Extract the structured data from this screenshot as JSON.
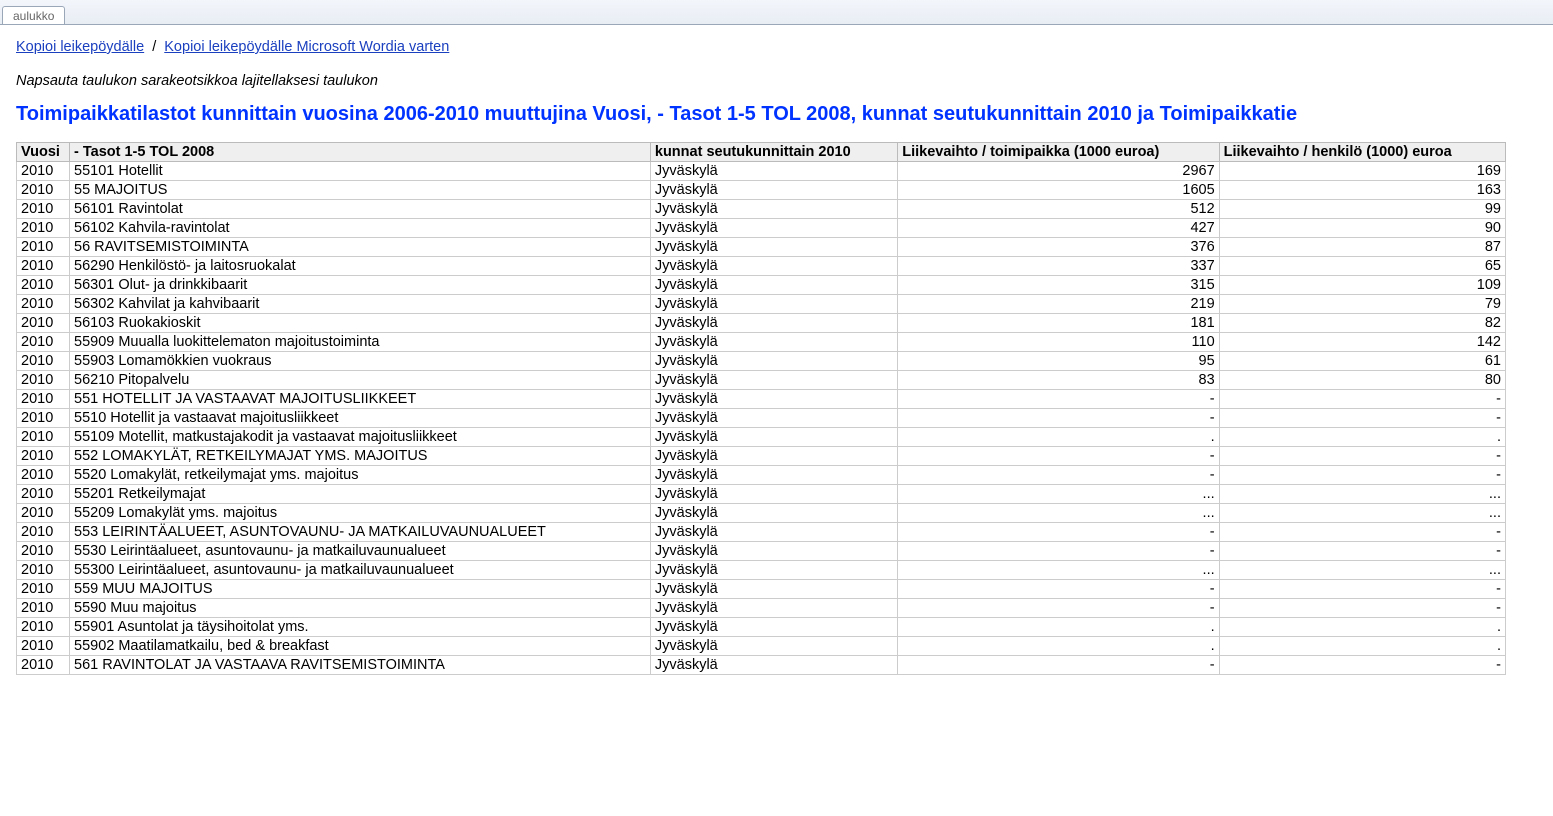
{
  "tab_label": "aulukko",
  "links": {
    "copy_clipboard": "Kopioi leikepöydälle",
    "copy_word": "Kopioi leikepöydälle Microsoft Wordia varten",
    "separator": "/"
  },
  "hint": "Napsauta taulukon sarakeotsikkoa lajitellaksesi taulukon",
  "title": "Toimipaikkatilastot kunnittain vuosina 2006-2010 muuttujina Vuosi, - Tasot 1-5 TOL 2008, kunnat seutukunnittain 2010 ja Toimipaikkatie",
  "columns": [
    "Vuosi",
    "- Tasot 1-5 TOL 2008",
    "kunnat seutukunnittain 2010",
    "Liikevaihto / toimipaikka (1000 euroa)",
    "Liikevaihto / henkilö (1000) euroa"
  ],
  "rows": [
    {
      "y": "2010",
      "t": "55101 Hotellit",
      "k": "Jyväskylä",
      "a": "2967",
      "b": "169"
    },
    {
      "y": "2010",
      "t": "55 MAJOITUS",
      "k": "Jyväskylä",
      "a": "1605",
      "b": "163"
    },
    {
      "y": "2010",
      "t": "56101 Ravintolat",
      "k": "Jyväskylä",
      "a": "512",
      "b": "99"
    },
    {
      "y": "2010",
      "t": "56102 Kahvila-ravintolat",
      "k": "Jyväskylä",
      "a": "427",
      "b": "90"
    },
    {
      "y": "2010",
      "t": "56 RAVITSEMISTOIMINTA",
      "k": "Jyväskylä",
      "a": "376",
      "b": "87"
    },
    {
      "y": "2010",
      "t": "56290 Henkilöstö- ja laitosruokalat",
      "k": "Jyväskylä",
      "a": "337",
      "b": "65"
    },
    {
      "y": "2010",
      "t": "56301 Olut- ja drinkkibaarit",
      "k": "Jyväskylä",
      "a": "315",
      "b": "109"
    },
    {
      "y": "2010",
      "t": "56302 Kahvilat ja kahvibaarit",
      "k": "Jyväskylä",
      "a": "219",
      "b": "79"
    },
    {
      "y": "2010",
      "t": "56103 Ruokakioskit",
      "k": "Jyväskylä",
      "a": "181",
      "b": "82"
    },
    {
      "y": "2010",
      "t": "55909 Muualla luokittelematon majoitustoiminta",
      "k": "Jyväskylä",
      "a": "110",
      "b": "142"
    },
    {
      "y": "2010",
      "t": "55903 Lomamökkien vuokraus",
      "k": "Jyväskylä",
      "a": "95",
      "b": "61"
    },
    {
      "y": "2010",
      "t": "56210 Pitopalvelu",
      "k": "Jyväskylä",
      "a": "83",
      "b": "80"
    },
    {
      "y": "2010",
      "t": "551 HOTELLIT JA VASTAAVAT MAJOITUSLIIKKEET",
      "k": "Jyväskylä",
      "a": "-",
      "b": "-"
    },
    {
      "y": "2010",
      "t": "5510 Hotellit ja vastaavat majoitusliikkeet",
      "k": "Jyväskylä",
      "a": "-",
      "b": "-"
    },
    {
      "y": "2010",
      "t": "55109 Motellit, matkustajakodit ja vastaavat majoitusliikkeet",
      "k": "Jyväskylä",
      "a": ".",
      "b": "."
    },
    {
      "y": "2010",
      "t": "552 LOMAKYLÄT, RETKEILYMAJAT YMS. MAJOITUS",
      "k": "Jyväskylä",
      "a": "-",
      "b": "-"
    },
    {
      "y": "2010",
      "t": "5520 Lomakylät, retkeilymajat yms. majoitus",
      "k": "Jyväskylä",
      "a": "-",
      "b": "-"
    },
    {
      "y": "2010",
      "t": "55201 Retkeilymajat",
      "k": "Jyväskylä",
      "a": "...",
      "b": "..."
    },
    {
      "y": "2010",
      "t": "55209 Lomakylät yms. majoitus",
      "k": "Jyväskylä",
      "a": "...",
      "b": "..."
    },
    {
      "y": "2010",
      "t": "553 LEIRINTÄALUEET, ASUNTOVAUNU- JA MATKAILUVAUNUALUEET",
      "k": "Jyväskylä",
      "a": "-",
      "b": "-"
    },
    {
      "y": "2010",
      "t": "5530 Leirintäalueet, asuntovaunu- ja matkailuvaunualueet",
      "k": "Jyväskylä",
      "a": "-",
      "b": "-"
    },
    {
      "y": "2010",
      "t": "55300 Leirintäalueet, asuntovaunu- ja matkailuvaunualueet",
      "k": "Jyväskylä",
      "a": "...",
      "b": "..."
    },
    {
      "y": "2010",
      "t": "559 MUU MAJOITUS",
      "k": "Jyväskylä",
      "a": "-",
      "b": "-"
    },
    {
      "y": "2010",
      "t": "5590 Muu majoitus",
      "k": "Jyväskylä",
      "a": "-",
      "b": "-"
    },
    {
      "y": "2010",
      "t": "55901 Asuntolat ja täysihoitolat yms.",
      "k": "Jyväskylä",
      "a": ".",
      "b": "."
    },
    {
      "y": "2010",
      "t": "55902 Maatilamatkailu, bed & breakfast",
      "k": "Jyväskylä",
      "a": ".",
      "b": "."
    },
    {
      "y": "2010",
      "t": "561 RAVINTOLAT JA VASTAAVA RAVITSEMISTOIMINTA",
      "k": "Jyväskylä",
      "a": "-",
      "b": "-"
    }
  ]
}
